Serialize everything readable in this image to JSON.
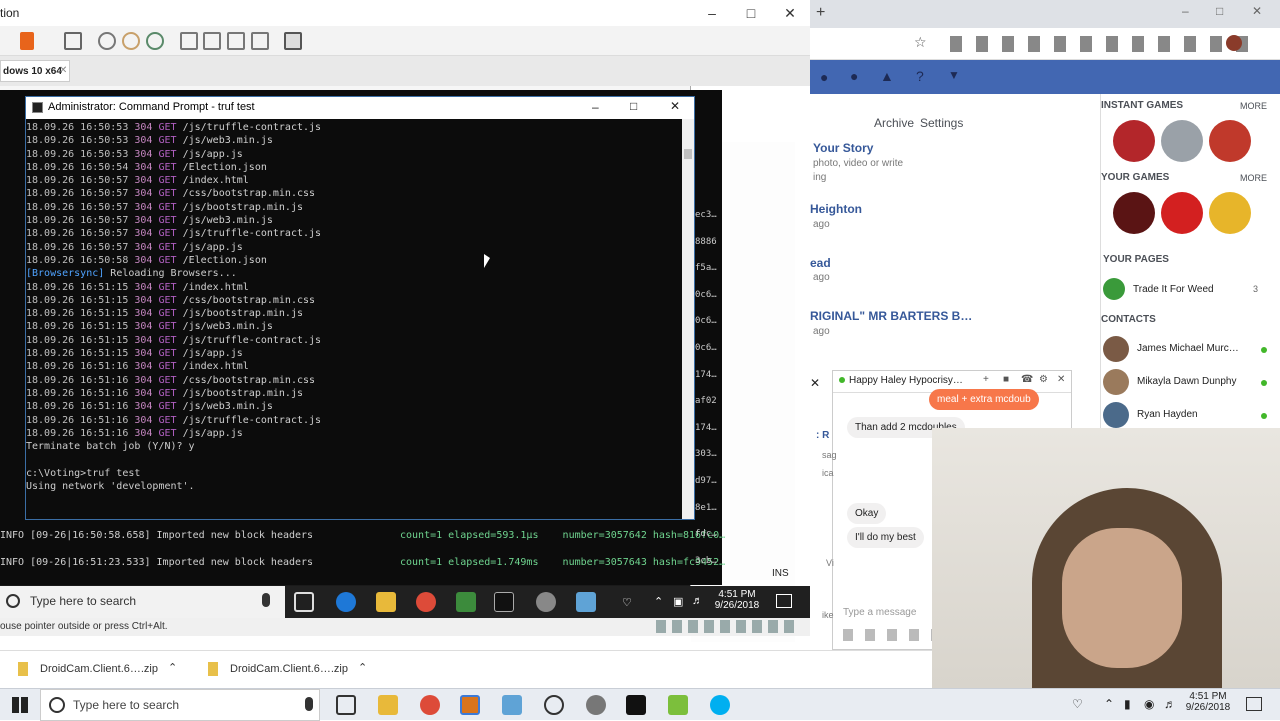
{
  "vm": {
    "title_fragment": "tion",
    "tab_label": "dows 10 x64",
    "status_text": "ouse pointer outside or press Ctrl+Alt."
  },
  "cmd": {
    "title": "Administrator: Command Prompt - truf  test",
    "log_lines": [
      {
        "ts": "18.09.26 16:50:53",
        "code": "304",
        "method": "GET",
        "path": "/js/truffle-contract.js"
      },
      {
        "ts": "18.09.26 16:50:53",
        "code": "304",
        "method": "GET",
        "path": "/js/web3.min.js"
      },
      {
        "ts": "18.09.26 16:50:53",
        "code": "304",
        "method": "GET",
        "path": "/js/app.js"
      },
      {
        "ts": "18.09.26 16:50:54",
        "code": "304",
        "method": "GET",
        "path": "/Election.json"
      },
      {
        "ts": "18.09.26 16:50:57",
        "code": "304",
        "method": "GET",
        "path": "/index.html"
      },
      {
        "ts": "18.09.26 16:50:57",
        "code": "304",
        "method": "GET",
        "path": "/css/bootstrap.min.css"
      },
      {
        "ts": "18.09.26 16:50:57",
        "code": "304",
        "method": "GET",
        "path": "/js/bootstrap.min.js"
      },
      {
        "ts": "18.09.26 16:50:57",
        "code": "304",
        "method": "GET",
        "path": "/js/web3.min.js"
      },
      {
        "ts": "18.09.26 16:50:57",
        "code": "304",
        "method": "GET",
        "path": "/js/truffle-contract.js"
      },
      {
        "ts": "18.09.26 16:50:57",
        "code": "304",
        "method": "GET",
        "path": "/js/app.js"
      },
      {
        "ts": "18.09.26 16:50:58",
        "code": "304",
        "method": "GET",
        "path": "/Election.json"
      }
    ],
    "browsersync_tag": "[Browsersync]",
    "browsersync_msg": " Reloading Browsers...",
    "log_lines2": [
      {
        "ts": "18.09.26 16:51:15",
        "code": "304",
        "method": "GET",
        "path": "/index.html"
      },
      {
        "ts": "18.09.26 16:51:15",
        "code": "304",
        "method": "GET",
        "path": "/css/bootstrap.min.css"
      },
      {
        "ts": "18.09.26 16:51:15",
        "code": "304",
        "method": "GET",
        "path": "/js/bootstrap.min.js"
      },
      {
        "ts": "18.09.26 16:51:15",
        "code": "304",
        "method": "GET",
        "path": "/js/web3.min.js"
      },
      {
        "ts": "18.09.26 16:51:15",
        "code": "304",
        "method": "GET",
        "path": "/js/truffle-contract.js"
      },
      {
        "ts": "18.09.26 16:51:15",
        "code": "304",
        "method": "GET",
        "path": "/js/app.js"
      },
      {
        "ts": "18.09.26 16:51:16",
        "code": "304",
        "method": "GET",
        "path": "/index.html"
      },
      {
        "ts": "18.09.26 16:51:16",
        "code": "304",
        "method": "GET",
        "path": "/css/bootstrap.min.css"
      },
      {
        "ts": "18.09.26 16:51:16",
        "code": "304",
        "method": "GET",
        "path": "/js/bootstrap.min.js"
      },
      {
        "ts": "18.09.26 16:51:16",
        "code": "304",
        "method": "GET",
        "path": "/js/web3.min.js"
      },
      {
        "ts": "18.09.26 16:51:16",
        "code": "304",
        "method": "GET",
        "path": "/js/truffle-contract.js"
      },
      {
        "ts": "18.09.26 16:51:16",
        "code": "304",
        "method": "GET",
        "path": "/js/app.js"
      }
    ],
    "terminate_line": "Terminate batch job (Y/N)? y",
    "prompt_line": "c:\\Voting>truf test",
    "network_line": "Using network 'development'."
  },
  "bg_term": {
    "line1": "INFO [09-26|16:50:58.658] Imported new block headers",
    "line1_stats": "count=1 elapsed=593.1µs    number=3057642 hash=816fc0…",
    "line2": "INFO [09-26|16:51:23.533] Imported new block headers",
    "line2_stats": "count=1 elapsed=1.749ms    number=3057643 hash=fc9452…",
    "side_hashes": [
      "ec3…",
      "8886",
      "f5a…",
      "0c6…",
      "0c6…",
      "0c6…",
      "174…",
      "af02",
      "174…",
      "303…",
      "d97…",
      "8e1…",
      "fdc…",
      "3cb…"
    ],
    "ins": "INS"
  },
  "guest_taskbar": {
    "search_placeholder": "Type here to search",
    "time": "4:51 PM",
    "date": "9/26/2018"
  },
  "browser": {
    "archive": "Archive",
    "settings": "Settings",
    "your_story": "Your Story",
    "story_sub": "photo, video or write",
    "story_sub2": "ing",
    "heighton": "Heighton",
    "ago1": "ago",
    "read": "ead",
    "ago2": "ago",
    "original": "RIGINAL\" MR BARTERS B…",
    "ago3": "ago",
    "instant_games": "INSTANT GAMES",
    "your_games": "YOUR GAMES",
    "more": "MORE",
    "your_pages": "YOUR PAGES",
    "page_name": "Trade It For Weed",
    "page_count": "3",
    "contacts_title": "CONTACTS",
    "contacts": [
      "James Michael Murc…",
      "Mikayla Dawn Dunphy",
      "Ryan Hayden"
    ]
  },
  "chat": {
    "title": "Happy Haley Hypocrisy…",
    "msg_top": "meal + extra mcdoub",
    "msg1": "Than add 2 mcdoubles",
    "msg2": "Okay",
    "msg3": "I'll do my best",
    "input_placeholder": "Type a message",
    "side_r": ": R",
    "side_sa": "sag",
    "side_ica": "ica",
    "side_vi": "Vi",
    "side_ike": "ike"
  },
  "downloads": [
    {
      "name": "DroidCam.Client.6….zip"
    },
    {
      "name": "DroidCam.Client.6….zip"
    }
  ],
  "host_taskbar": {
    "search_placeholder": "Type here to search",
    "time": "4:51 PM",
    "date": "9/26/2018"
  }
}
